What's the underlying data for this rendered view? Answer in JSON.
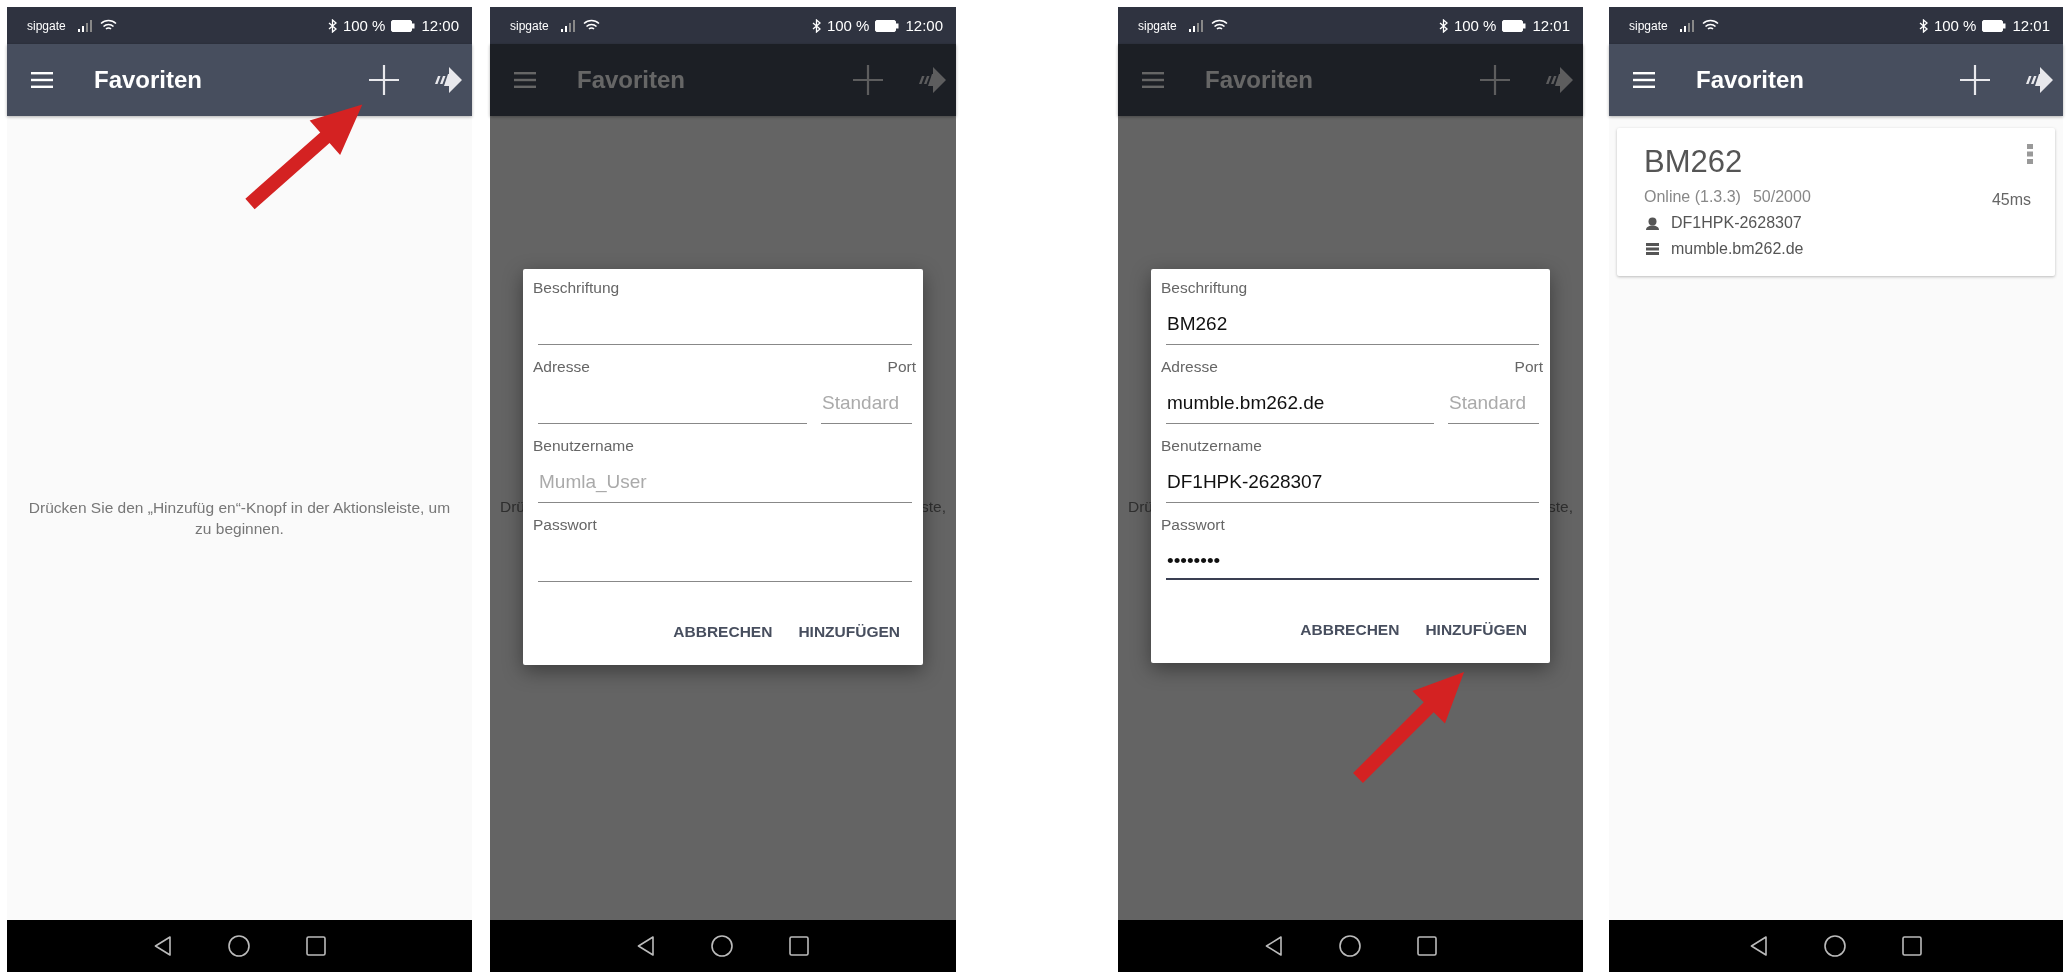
{
  "screens": [
    {
      "kind": "empty",
      "status_bar": {
        "carrier": "sipgate",
        "battery": "100 %",
        "time": "12:00"
      },
      "app_bar": {
        "title": "Favoriten"
      },
      "dimmed": false,
      "arrow": true,
      "message": "Drücken Sie den „Hinzufüg en“-Knopf in der Aktionsleiste, um zu beginnen."
    },
    {
      "kind": "dialog",
      "status_bar": {
        "carrier": "sipgate",
        "battery": "100 %",
        "time": "12:00"
      },
      "app_bar": {
        "title": "Favoriten"
      },
      "dimmed": true,
      "arrow": false,
      "behind_left": "Drü",
      "behind_right": "ste,",
      "dialog": {
        "rows": [
          {
            "fields": [
              {
                "label": "Beschriftung",
                "focused": false
              }
            ]
          },
          {
            "fields": [
              {
                "label": "Adresse",
                "focused": false
              },
              {
                "label": "Port",
                "placeholder": "Standard",
                "focused": false
              }
            ]
          },
          {
            "fields": [
              {
                "label": "Benutzername",
                "placeholder": "Mumla_User",
                "focused": false
              }
            ]
          },
          {
            "fields": [
              {
                "label": "Passwort",
                "focused": false
              }
            ]
          }
        ],
        "buttons": [
          "ABBRECHEN",
          "HINZUFÜGEN"
        ]
      }
    },
    {
      "kind": "dialog",
      "status_bar": {
        "carrier": "sipgate",
        "battery": "100 %",
        "time": "12:01"
      },
      "app_bar": {
        "title": "Favoriten"
      },
      "dimmed": true,
      "arrow": true,
      "behind_left": "Drü",
      "behind_right": "ste,",
      "dialog": {
        "rows": [
          {
            "fields": [
              {
                "label": "Beschriftung",
                "value": "BM262",
                "focused": false
              }
            ]
          },
          {
            "fields": [
              {
                "label": "Adresse",
                "value": "mumble.bm262.de",
                "focused": false
              },
              {
                "label": "Port",
                "placeholder": "Standard",
                "focused": false
              }
            ]
          },
          {
            "fields": [
              {
                "label": "Benutzername",
                "value": "DF1HPK-2628307",
                "focused": false
              }
            ]
          },
          {
            "fields": [
              {
                "label": "Passwort",
                "value": "••••••••",
                "focused": true
              }
            ]
          }
        ],
        "buttons": [
          "ABBRECHEN",
          "HINZUFÜGEN"
        ]
      }
    },
    {
      "kind": "list",
      "status_bar": {
        "carrier": "sipgate",
        "battery": "100 %",
        "time": "12:01"
      },
      "app_bar": {
        "title": "Favoriten"
      },
      "dimmed": false,
      "arrow": false,
      "servers": [
        {
          "name": "BM262",
          "status": "Online (1.3.3)",
          "users": "50/2000",
          "ping": "45ms",
          "username": "DF1HPK-2628307",
          "address": "mumble.bm262.de"
        }
      ]
    }
  ]
}
